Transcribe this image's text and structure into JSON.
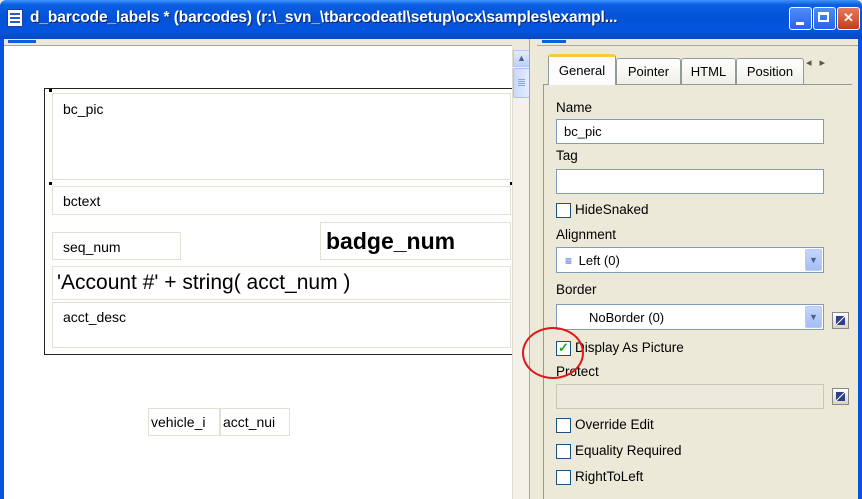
{
  "window": {
    "title": "d_barcode_labels * (barcodes) (r:\\_svn_\\tbarcodeatl\\setup\\ocx\\samples\\exampl..."
  },
  "design": {
    "fields": {
      "bc_pic": "bc_pic",
      "bctext": "bctext",
      "seq_num": "seq_num",
      "badge_num": "badge_num",
      "account_expr": "'Account #' + string( acct_num )",
      "acct_desc": "acct_desc",
      "vehicle": "vehicle_i",
      "acct_num": "acct_nui"
    }
  },
  "properties": {
    "tabs": [
      "General",
      "Pointer",
      "HTML",
      "Position"
    ],
    "name_label": "Name",
    "name_value": "bc_pic",
    "tag_label": "Tag",
    "tag_value": "",
    "hide_snaked_label": "HideSnaked",
    "alignment_label": "Alignment",
    "alignment_value": "Left (0)",
    "border_label": "Border",
    "border_value": "NoBorder (0)",
    "display_as_picture_label": "Display As Picture",
    "display_as_picture_checked": true,
    "protect_label": "Protect",
    "protect_value": "",
    "override_edit_label": "Override Edit",
    "equality_required_label": "Equality Required",
    "right_to_left_label": "RightToLeft"
  },
  "colors": {
    "title_bar": "#0454e0",
    "highlight_circle": "#e01818",
    "active_tab_accent": "#ffc83c"
  }
}
